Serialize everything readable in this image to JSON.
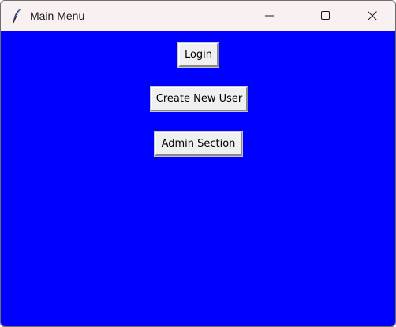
{
  "window": {
    "title": "Main Menu",
    "icon": "feather-icon"
  },
  "controls": {
    "minimize_icon": "minimize-icon",
    "maximize_icon": "maximize-icon",
    "close_icon": "close-icon"
  },
  "menu": {
    "login_label": "Login",
    "create_user_label": "Create New User",
    "admin_label": "Admin Section"
  },
  "colors": {
    "background": "#0000ff",
    "titlebar": "#f9f1f1",
    "button_face": "#f0f0f0"
  }
}
